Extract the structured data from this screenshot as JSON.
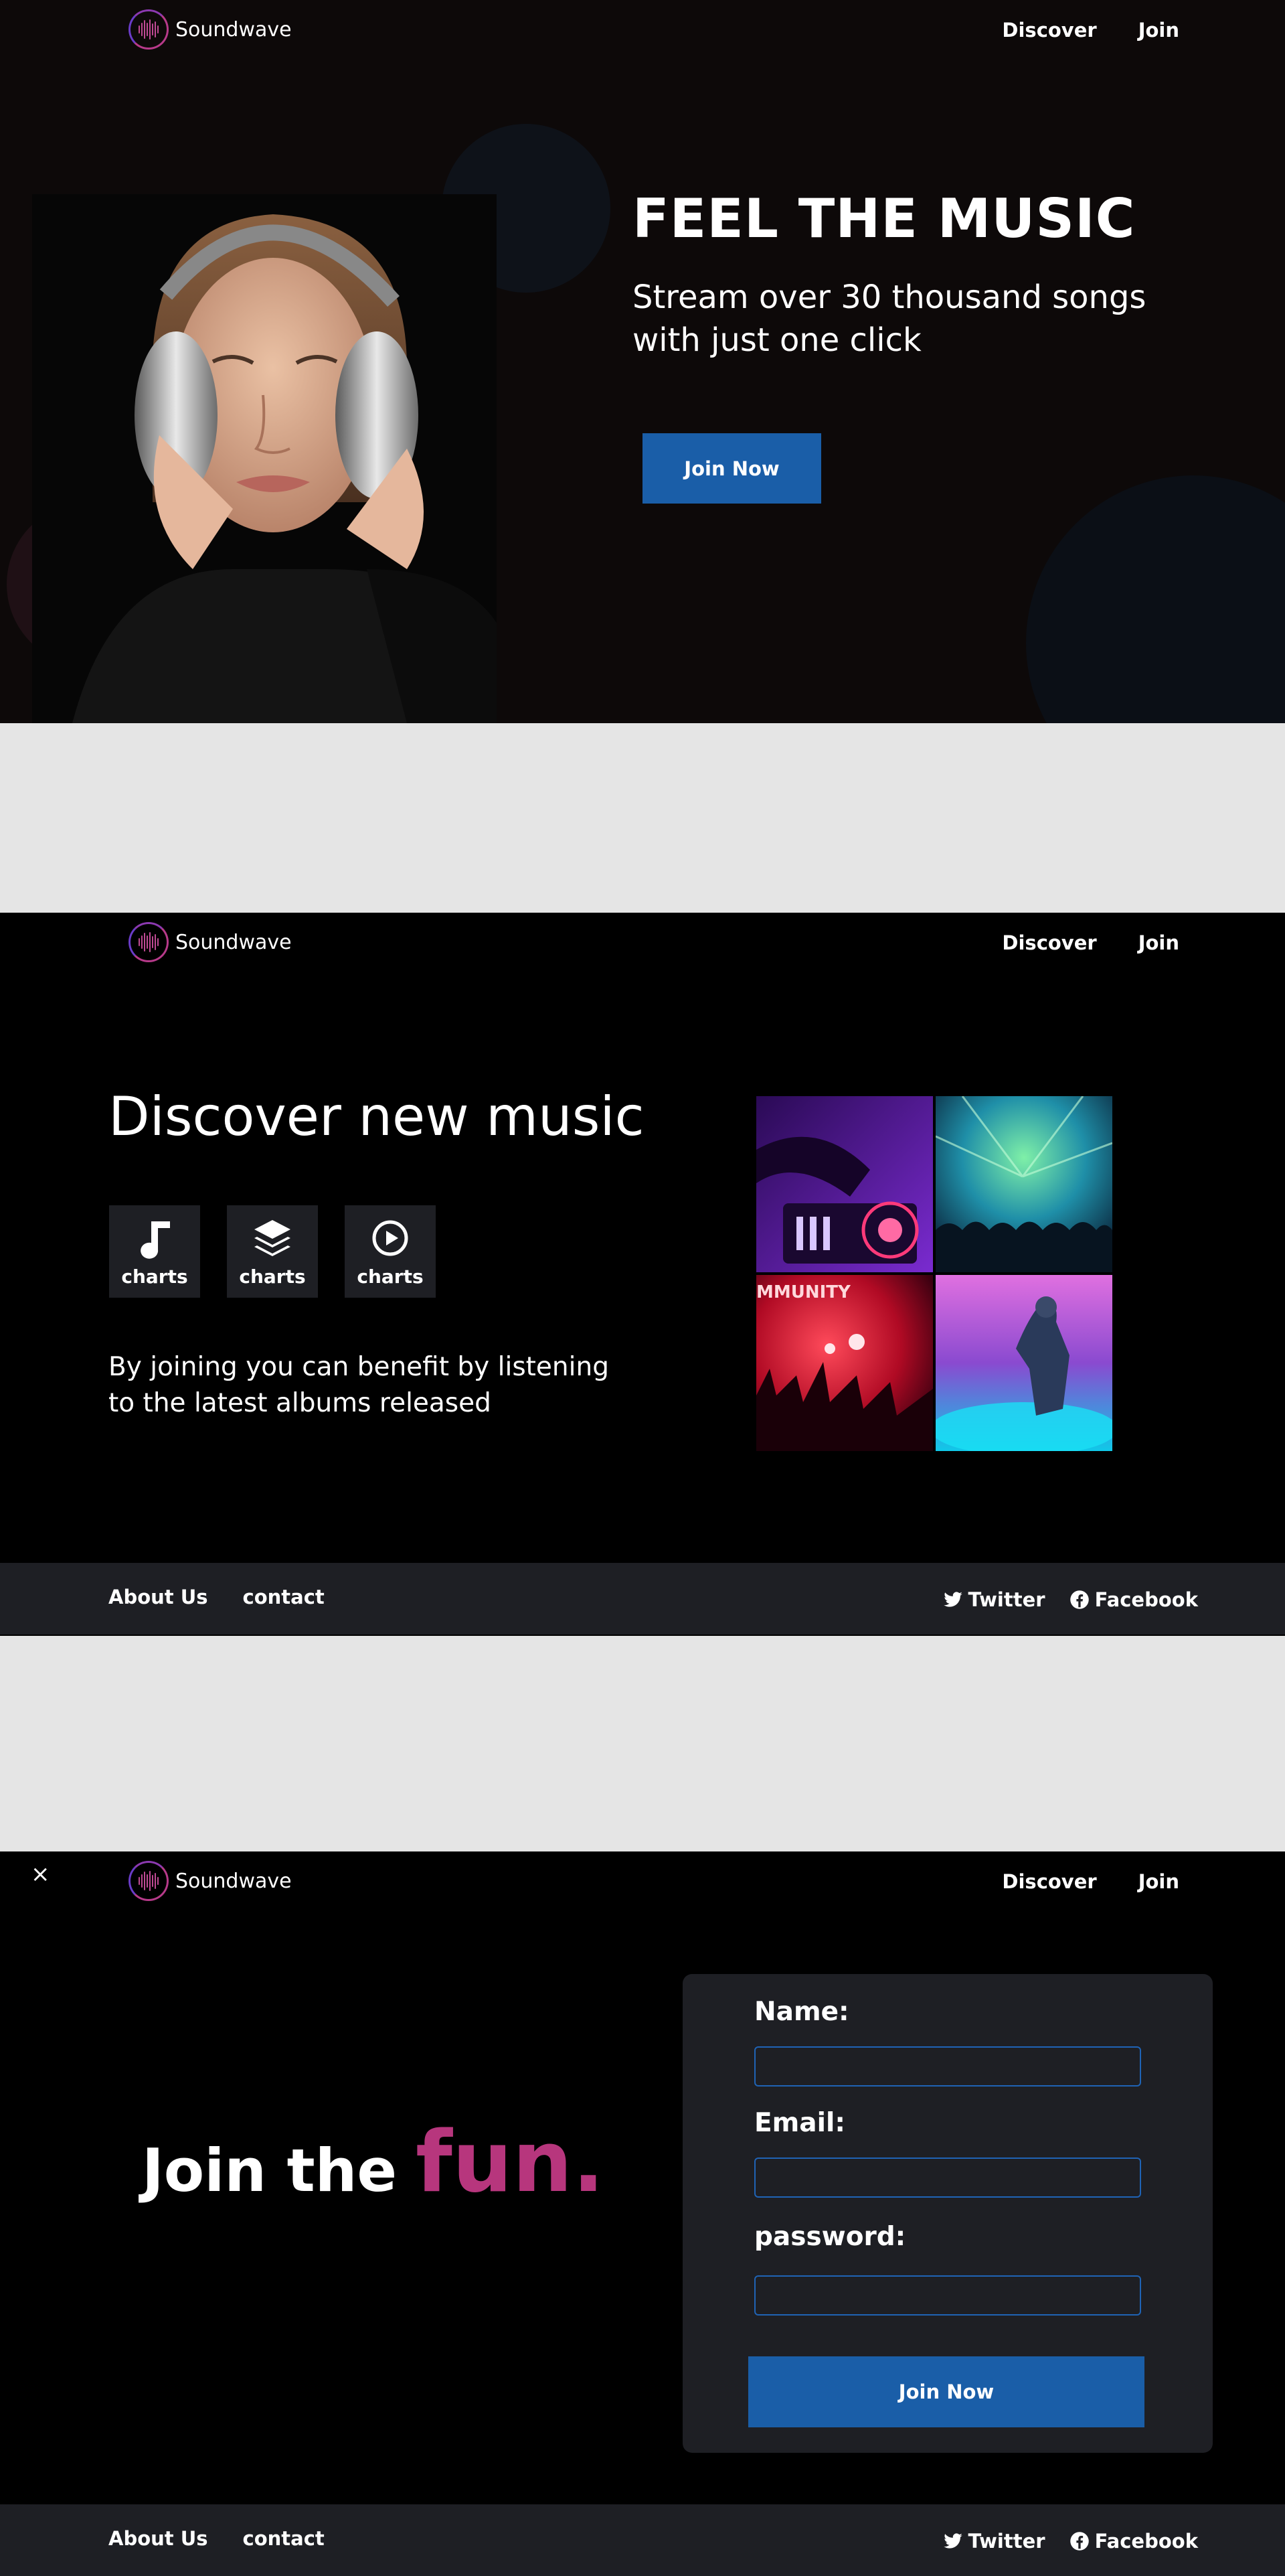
{
  "brand": {
    "name": "Soundwave"
  },
  "nav": {
    "discover": "Discover",
    "join": "Join"
  },
  "hero": {
    "title": "FEEL THE MUSIC",
    "subtitle": "Stream over 30 thousand songs with just one click",
    "cta": "Join Now"
  },
  "discover": {
    "title": "Discover new music",
    "features": [
      {
        "icon": "music-note-icon",
        "label": "charts"
      },
      {
        "icon": "layers-icon",
        "label": "charts"
      },
      {
        "icon": "play-circle-icon",
        "label": "charts"
      }
    ],
    "description": "By joining you can benefit by listening to the latest albums released",
    "tile_text": "MMUNITY"
  },
  "footer": {
    "about": "About Us",
    "contact": "contact",
    "twitter": "Twitter",
    "facebook": "Facebook"
  },
  "join": {
    "close": "×",
    "heading_a": "Join the",
    "heading_b": "fun.",
    "name_label": "Name:",
    "email_label": "Email:",
    "password_label": "password:",
    "name_value": "",
    "email_value": "",
    "password_value": "",
    "submit": "Join Now"
  },
  "colors": {
    "accent_blue": "#1a5ea8",
    "accent_pink": "#b7367d",
    "panel": "#1e1f24"
  }
}
